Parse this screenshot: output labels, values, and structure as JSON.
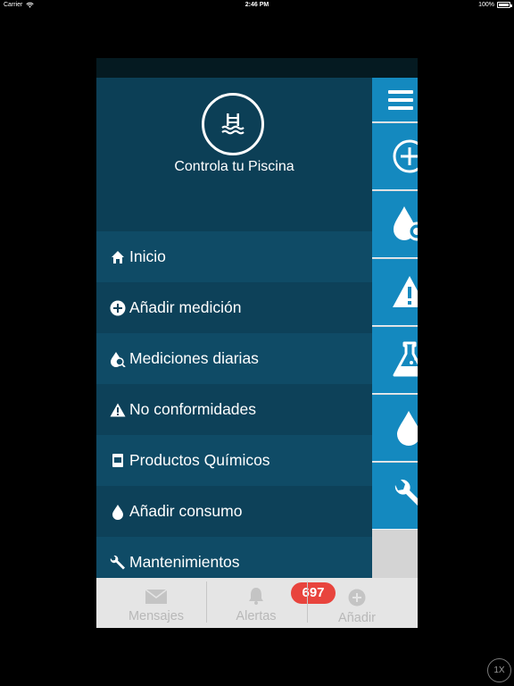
{
  "status_bar": {
    "carrier": "Carrier",
    "time": "2:46 PM",
    "battery": "100%"
  },
  "drawer": {
    "title": "Controla tu Piscina",
    "logo_icon": "pool-icon",
    "items": [
      {
        "label": "Inicio",
        "icon": "home-icon"
      },
      {
        "label": "Añadir medición",
        "icon": "plus-circle-icon"
      },
      {
        "label": "Mediciones diarias",
        "icon": "drop-search-icon"
      },
      {
        "label": "No conformidades",
        "icon": "warning-icon"
      },
      {
        "label": "Productos Químicos",
        "icon": "chemical-container-icon"
      },
      {
        "label": "Añadir consumo",
        "icon": "drop-icon"
      },
      {
        "label": "Mantenimientos",
        "icon": "wrench-icon"
      }
    ]
  },
  "rail": {
    "buttons": [
      "menu-icon",
      "plus-circle-icon",
      "drop-search-icon",
      "warning-icon",
      "flask-icon",
      "drop-icon",
      "wrench-icon"
    ]
  },
  "tabbar": {
    "tabs": [
      {
        "label": "Mensajes",
        "icon": "envelope-icon"
      },
      {
        "label": "Alertas",
        "icon": "bell-icon",
        "badge": "697"
      },
      {
        "label": "Añadir",
        "icon": "plus-circle-icon"
      }
    ]
  },
  "zoom": "1X",
  "colors": {
    "drawer_bg": "#0d3f57",
    "rail_blue": "#1489bf",
    "badge_red": "#e8443d",
    "tabbar_bg": "#e5e5e5"
  }
}
